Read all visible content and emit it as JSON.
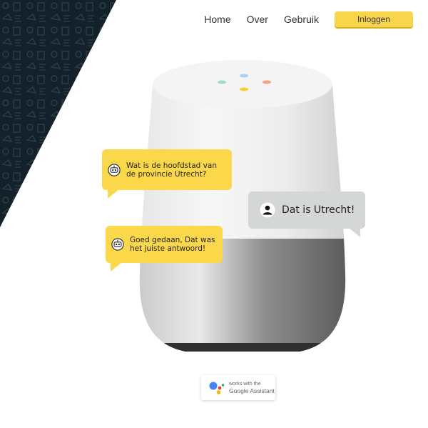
{
  "nav": {
    "items": [
      {
        "label": "Home"
      },
      {
        "label": "Over"
      },
      {
        "label": "Gebruik"
      }
    ],
    "login_label": "Inloggen"
  },
  "colors": {
    "accent": "#fbd84a",
    "pattern_bg": "#13222a",
    "user_bubble": "#d5d7d7"
  },
  "chat": {
    "bot_question": {
      "line1": "Wat is de hoofdstad van",
      "line2": "de provincie Utrecht?"
    },
    "user_answer": "Dat is Utrecht!",
    "bot_feedback": {
      "line1": "Goed gedaan, Dat was",
      "line2": "het juiste antwoord!"
    }
  },
  "badge": {
    "line1": "works with the",
    "line2": "Google Assistant"
  },
  "icons": {
    "bot": "robot-icon",
    "user": "user-icon",
    "assistant": "google-assistant-icon"
  }
}
